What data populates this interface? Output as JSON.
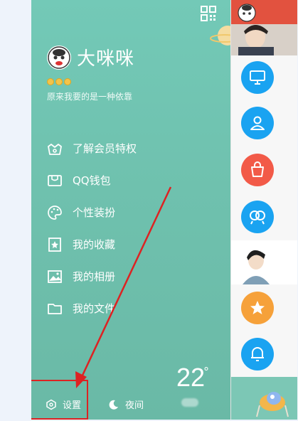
{
  "profile": {
    "username": "大咪咪",
    "signature": "原来我要的是一种依靠"
  },
  "menu": {
    "items": [
      {
        "label": "了解会员特权",
        "icon": "vip-crown-icon"
      },
      {
        "label": "QQ钱包",
        "icon": "wallet-icon"
      },
      {
        "label": "个性装扮",
        "icon": "palette-icon"
      },
      {
        "label": "我的收藏",
        "icon": "bookmark-star-icon"
      },
      {
        "label": "我的相册",
        "icon": "photo-album-icon"
      },
      {
        "label": "我的文件",
        "icon": "folder-icon"
      }
    ]
  },
  "weather": {
    "temperature": "22",
    "degree_symbol": "°"
  },
  "bottom_bar": {
    "settings_label": "设置",
    "night_label": "夜间"
  },
  "colors": {
    "drawer_bg": "#6fc1ae",
    "highlight": "#dd2222",
    "blue_icon": "#1aa3f1",
    "red_icon": "#f25a48",
    "orange_icon": "#f6a13a"
  }
}
